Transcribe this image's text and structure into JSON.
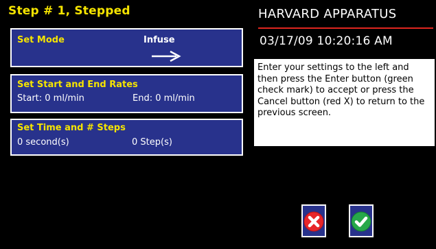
{
  "header": {
    "step_title": "Step # 1, Stepped",
    "brand": "HARVARD APPARATUS",
    "datetime": "03/17/09 10:20:16 AM"
  },
  "panels": {
    "mode": {
      "title": "Set Mode",
      "value": "Infuse",
      "icon": "right-arrow-icon"
    },
    "rates": {
      "title": "Set Start and End Rates",
      "start": "Start: 0 ml/min",
      "end": "End: 0 ml/min"
    },
    "time": {
      "title": "Set Time and # Steps",
      "seconds": "0 second(s)",
      "steps": "0 Step(s)"
    }
  },
  "info": {
    "text": "Enter your settings to the left and then press the Enter button (green check mark) to accept or press the Cancel button (red X) to return to the previous screen."
  },
  "buttons": {
    "cancel_icon": "red-x-icon",
    "enter_icon": "green-check-icon"
  },
  "colors": {
    "panel_blue": "#28328c",
    "title_yellow": "#f5e400",
    "rule_red": "#e0261f",
    "cancel_red": "#e8262a",
    "enter_green": "#27a84a"
  }
}
